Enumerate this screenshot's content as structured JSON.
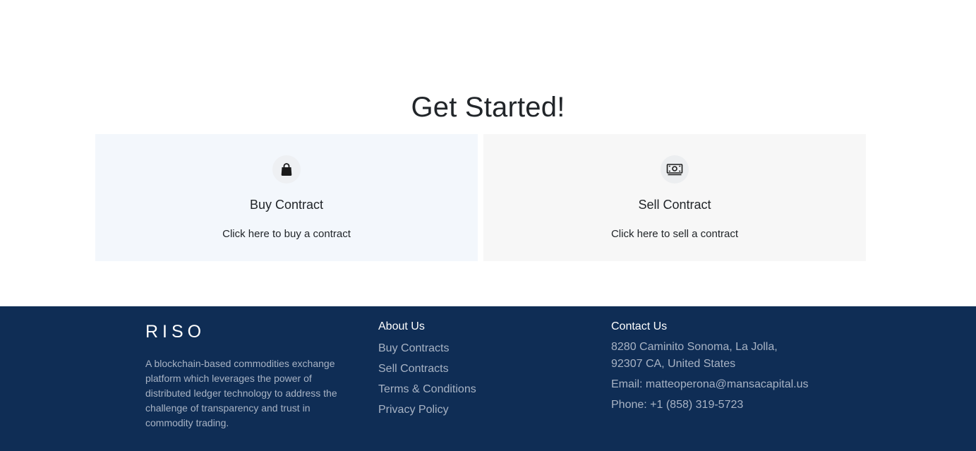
{
  "main": {
    "heading": "Get Started!",
    "cards": [
      {
        "title": "Buy Contract",
        "text": "Click here to buy a contract",
        "icon": "shopping-bag-icon"
      },
      {
        "title": "Sell Contract",
        "text": "Click here to sell a contract",
        "icon": "cash-icon"
      }
    ]
  },
  "footer": {
    "brand": {
      "logo": "RISO",
      "tagline": "A blockchain-based commodities exchange platform which leverages the power of distributed ledger technology to address the challenge of transparency and trust in commodity trading."
    },
    "about": {
      "heading": "About Us",
      "links": [
        "Buy Contracts",
        "Sell Contracts",
        "Terms & Conditions",
        "Privacy Policy"
      ]
    },
    "contact": {
      "heading": "Contact Us",
      "address_line1": "8280 Caminito Sonoma, La Jolla,",
      "address_line2": "92307 CA, United States",
      "email": "Email: matteoperona@mansacapital.us",
      "phone": "Phone: +1 (858) 319-5723"
    },
    "colors": {
      "background": "#0f2d55",
      "heading": "#ffffff",
      "muted": "#a8b3c4"
    }
  }
}
